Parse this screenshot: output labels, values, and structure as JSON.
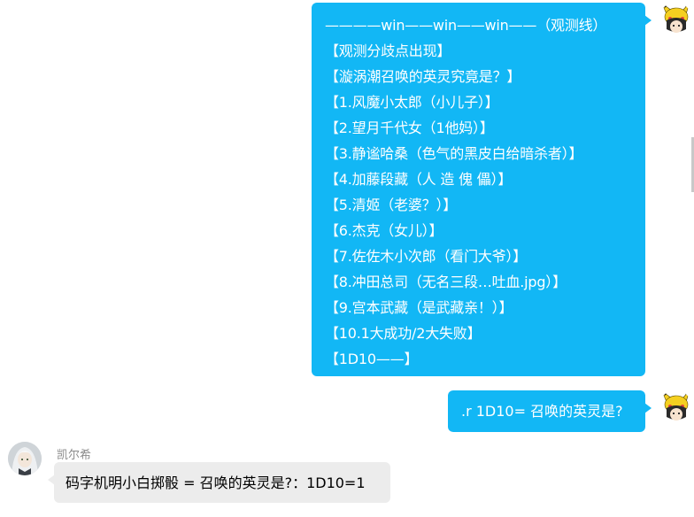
{
  "messages": {
    "first": {
      "lines": [
        "————win——win——win——（观测线）",
        "【观测分歧点出现】",
        "【漩涡潮召唤的英灵究竟是？】",
        "【1.风魔小太郎（小儿子）】",
        "【2.望月千代女（1他妈）】",
        "【3.静谧哈桑（色气的黑皮白给暗杀者）】",
        "【4.加藤段藏（人 造 傀 儡）】",
        "【5.清姬（老婆？）】",
        "【6.杰克（女儿）】",
        "【7.佐佐木小次郎（看门大爷）】",
        "【8.冲田总司（无名三段…吐血.jpg）】",
        "【9.宫本武藏（是武藏亲！）】",
        "【10.1大成功/2大失败】",
        "【1D10——】"
      ]
    },
    "second": {
      "text": ".r 1D10= 召唤的英灵是?"
    },
    "reply": {
      "sender": "凯尔希",
      "text": "码字机明小白掷骰 = 召唤的英灵是?：1D10=1"
    }
  },
  "colors": {
    "self_bubble": "#12b7f5",
    "other_bubble": "#ececec",
    "sender_name": "#8c8c8c"
  },
  "icons": {
    "self_avatar": "pikachu-hat-anime-avatar-icon",
    "other_avatar": "white-haired-character-avatar-icon"
  }
}
